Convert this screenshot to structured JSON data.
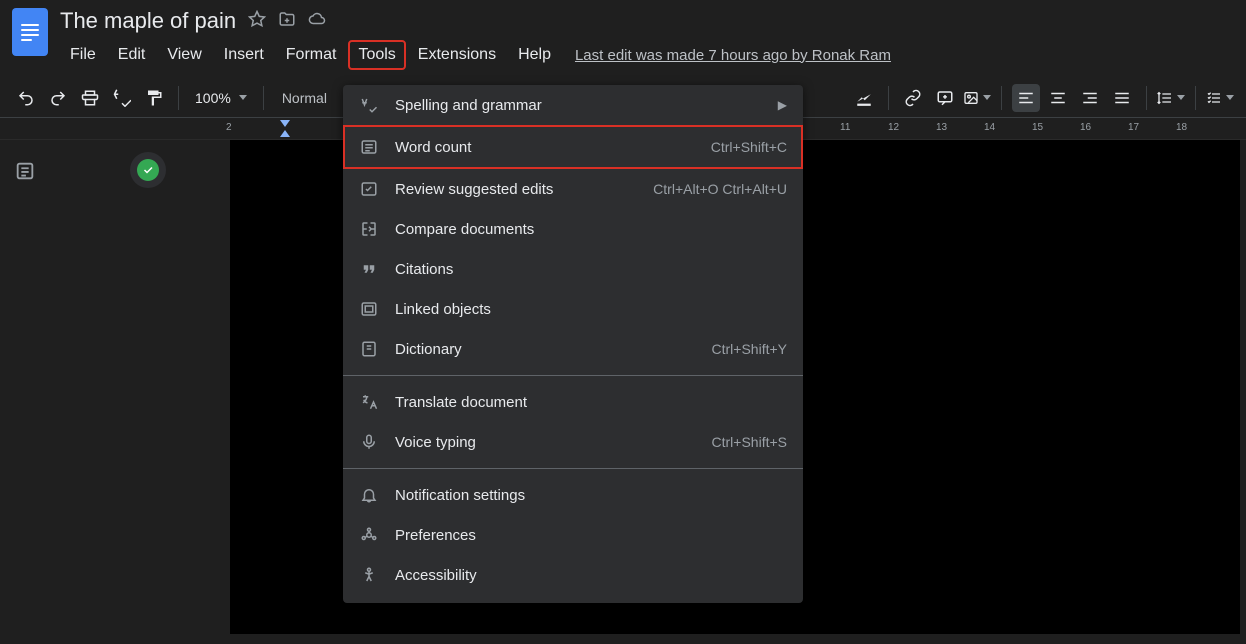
{
  "doc": {
    "title": "The maple of pain"
  },
  "menubar": {
    "items": [
      "File",
      "Edit",
      "View",
      "Insert",
      "Format",
      "Tools",
      "Extensions",
      "Help"
    ],
    "last_edit": "Last edit was made 7 hours ago by Ronak Ram"
  },
  "toolbar": {
    "zoom": "100%",
    "style": "Normal"
  },
  "ruler": {
    "marks": [
      "2",
      "11",
      "12",
      "13",
      "14",
      "15",
      "16",
      "17",
      "18"
    ]
  },
  "dropdown": {
    "groups": [
      [
        {
          "icon": "spellcheck",
          "label": "Spelling and grammar",
          "shortcut": "",
          "arrow": true
        },
        {
          "icon": "word-count",
          "label": "Word count",
          "shortcut": "Ctrl+Shift+C",
          "highlighted": true
        },
        {
          "icon": "review",
          "label": "Review suggested edits",
          "shortcut": "Ctrl+Alt+O Ctrl+Alt+U"
        },
        {
          "icon": "compare",
          "label": "Compare documents",
          "shortcut": ""
        },
        {
          "icon": "citations",
          "label": "Citations",
          "shortcut": ""
        },
        {
          "icon": "linked",
          "label": "Linked objects",
          "shortcut": ""
        },
        {
          "icon": "dictionary",
          "label": "Dictionary",
          "shortcut": "Ctrl+Shift+Y"
        }
      ],
      [
        {
          "icon": "translate",
          "label": "Translate document",
          "shortcut": ""
        },
        {
          "icon": "voice",
          "label": "Voice typing",
          "shortcut": "Ctrl+Shift+S"
        }
      ],
      [
        {
          "icon": "bell",
          "label": "Notification settings",
          "shortcut": ""
        },
        {
          "icon": "prefs",
          "label": "Preferences",
          "shortcut": ""
        },
        {
          "icon": "access",
          "label": "Accessibility",
          "shortcut": ""
        }
      ]
    ]
  }
}
